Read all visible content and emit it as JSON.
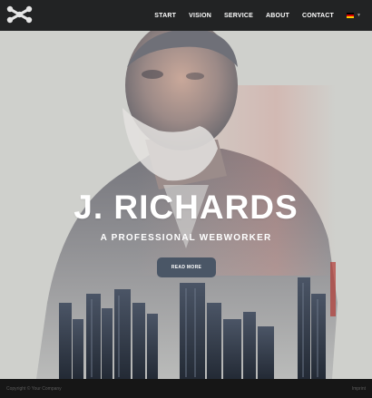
{
  "header": {
    "logo_icon": "x-molecule-logo",
    "nav": [
      {
        "label": "START"
      },
      {
        "label": "VISION"
      },
      {
        "label": "SERVICE"
      },
      {
        "label": "ABOUT"
      },
      {
        "label": "CONTACT"
      }
    ],
    "language": {
      "icon": "german-flag-icon",
      "colors": [
        "#000000",
        "#dd0000",
        "#ffce00"
      ]
    }
  },
  "hero": {
    "title": "J. RICHARDS",
    "subtitle": "A PROFESSIONAL WEBWORKER",
    "button_label": "READ MORE",
    "button_color": "#4a5666"
  },
  "footer": {
    "copyright": "Copyright © Your Company",
    "imprint": "Imprint"
  },
  "colors": {
    "header_bg": "#222324",
    "hero_bg": "#cfd0cc",
    "footer_bg": "#161616"
  }
}
